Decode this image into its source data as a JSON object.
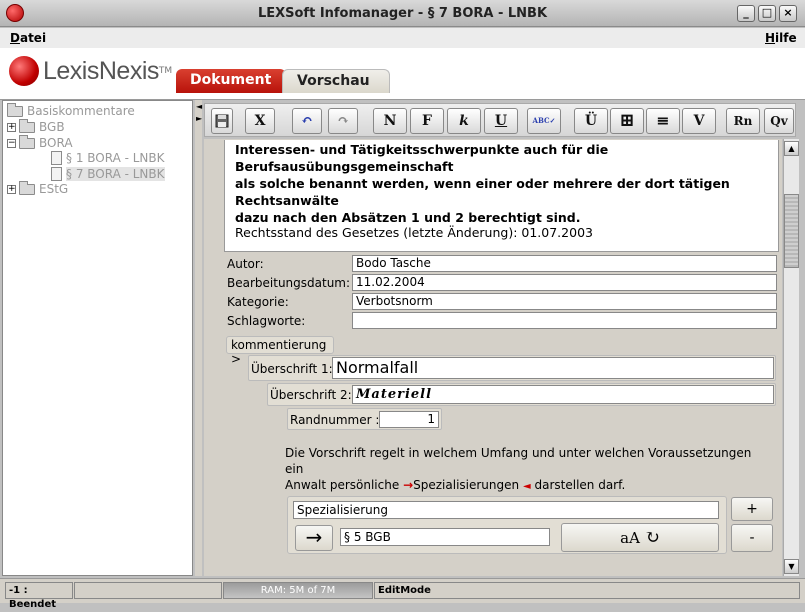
{
  "window": {
    "title": "LEXSoft Infomanager - § 7 BORA - LNBK",
    "minimize": "_",
    "maximize": "□",
    "close": "×"
  },
  "menu": {
    "datei": "Datei",
    "hilfe": "Hilfe"
  },
  "logo": {
    "brand": "LexisNexis",
    "tm": "TM"
  },
  "tabs": {
    "dokument": "Dokument",
    "vorschau": "Vorschau"
  },
  "tree": {
    "root": "Basiskommentare",
    "bgb": "BGB",
    "bora": "BORA",
    "item1": "§ 1 BORA - LNBK",
    "item7": "§ 7 BORA - LNBK",
    "estg": "EStG"
  },
  "toolbar": {
    "cut": "X",
    "undo": "↶",
    "redo": "↷",
    "normal": "N",
    "fett": "F",
    "kursiv": "k",
    "underline": "U",
    "spell": "ABC✓",
    "ue": "Ü",
    "table": "⊞",
    "list": "≡",
    "v": "V",
    "rn": "Rn",
    "qv": "Qv"
  },
  "document": {
    "line1": "Interessen- und Tätigkeitsschwerpunkte auch für die Berufsausübungsgemeinschaft",
    "line2": "als solche benannt werden, wenn einer oder mehrere der dort tätigen Rechtsanwälte",
    "line3": "dazu nach den Absätzen 1 und 2 berechtigt sind.",
    "rechtsstand": "Rechtsstand des Gesetzes (letzte Änderung): 01.07.2003"
  },
  "meta": {
    "autor_label": "Autor:",
    "autor_value": "Bodo Tasche",
    "datum_label": "Bearbeitungsdatum:",
    "datum_value": "11.02.2004",
    "kategorie_label": "Kategorie:",
    "kategorie_value": "Verbotsnorm",
    "schlagworte_label": "Schlagworte:",
    "schlagworte_value": ""
  },
  "kommentierung": "kommentierung >",
  "ueberschrift1": {
    "label": "Überschrift 1:",
    "value": "Normalfall"
  },
  "ueberschrift2": {
    "label": "Überschrift 2:",
    "value": "Materiell"
  },
  "randnummer": {
    "label": "Randnummer :",
    "value": "1"
  },
  "paragraph": {
    "part1": "Die Vorschrift regelt in welchem Umfang und unter welchen Voraussetzungen ein",
    "part2": "Anwalt persönliche",
    "arrow": "→",
    "link": "Spezialisierungen",
    "endmark": "◄",
    "part3": "darstellen darf."
  },
  "reference": {
    "title": "Spezialisierung",
    "target": "§ 5 BGB",
    "arrow": "→",
    "case": "aA",
    "cycle": "↻",
    "plus": "+",
    "minus": "-"
  },
  "status": {
    "state": "-1 : Beendet",
    "ram": "RAM: 5M of 7M",
    "mode": "EditMode"
  }
}
